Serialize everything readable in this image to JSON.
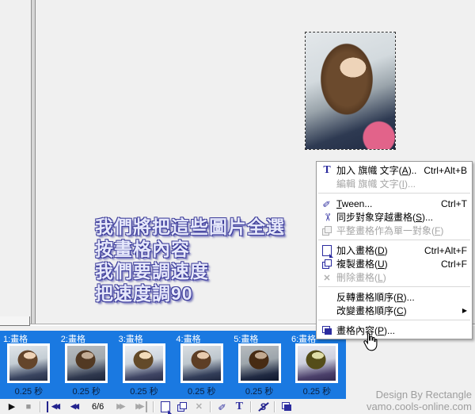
{
  "annotation": {
    "lines": [
      "我們將把這些圖片全選",
      "按畫格內容",
      "我們要調速度",
      "把速度調90"
    ]
  },
  "context_menu": {
    "items": [
      {
        "label": "加入 旗幟 文字(A)...",
        "shortcut": "Ctrl+Alt+B",
        "icon": "banner-text-icon",
        "enabled": true
      },
      {
        "label": "編輯 旗幟 文字(I)...",
        "shortcut": "",
        "icon": "",
        "enabled": false
      },
      {
        "type": "separator"
      },
      {
        "label": "Tween...",
        "shortcut": "Ctrl+T",
        "icon": "tween-icon",
        "enabled": true
      },
      {
        "label": "同步對象穿越畫格(S)...",
        "shortcut": "",
        "icon": "sync-objects-icon",
        "enabled": true
      },
      {
        "label": "平整畫格作為單一對象(F)",
        "shortcut": "",
        "icon": "flatten-frames-icon",
        "enabled": false
      },
      {
        "type": "separator"
      },
      {
        "label": "加入畫格(D)",
        "shortcut": "Ctrl+Alt+F",
        "icon": "add-frame-icon",
        "enabled": true
      },
      {
        "label": "複製畫格(U)",
        "shortcut": "Ctrl+F",
        "icon": "duplicate-frame-icon",
        "enabled": true
      },
      {
        "label": "刪除畫格(L)",
        "shortcut": "",
        "icon": "delete-frame-icon",
        "enabled": false
      },
      {
        "type": "separator"
      },
      {
        "label": "反轉畫格順序(R)...",
        "shortcut": "",
        "icon": "",
        "enabled": true
      },
      {
        "label": "改變畫格順序(C)",
        "shortcut": "",
        "icon": "",
        "enabled": true,
        "submenu": true
      },
      {
        "type": "separator"
      },
      {
        "label": "畫格內容(P)...",
        "shortcut": "",
        "icon": "frame-properties-icon",
        "enabled": true
      }
    ]
  },
  "frame_strip": {
    "frames": [
      {
        "label": "1:畫格",
        "duration": "0.25 秒"
      },
      {
        "label": "2:畫格",
        "duration": "0.25 秒"
      },
      {
        "label": "3:畫格",
        "duration": "0.25 秒"
      },
      {
        "label": "4:畫格",
        "duration": "0.25 秒"
      },
      {
        "label": "5:畫格",
        "duration": "0.25 秒"
      },
      {
        "label": "6:畫格",
        "duration": "0.25 秒"
      }
    ]
  },
  "transport": {
    "position": "6/6",
    "icons": [
      "play-icon",
      "stop-icon",
      "first-frame-icon",
      "previous-frame-icon",
      "next-frame-icon",
      "last-frame-icon",
      "add-frame-icon",
      "duplicate-frame-icon",
      "delete-frame-icon",
      "tween-icon",
      "banner-text-icon",
      "sync-objects-icon",
      "frame-properties-icon"
    ]
  },
  "watermark": {
    "line1": "Design By Rectangle",
    "line2": "vamo.cools-online.com"
  }
}
